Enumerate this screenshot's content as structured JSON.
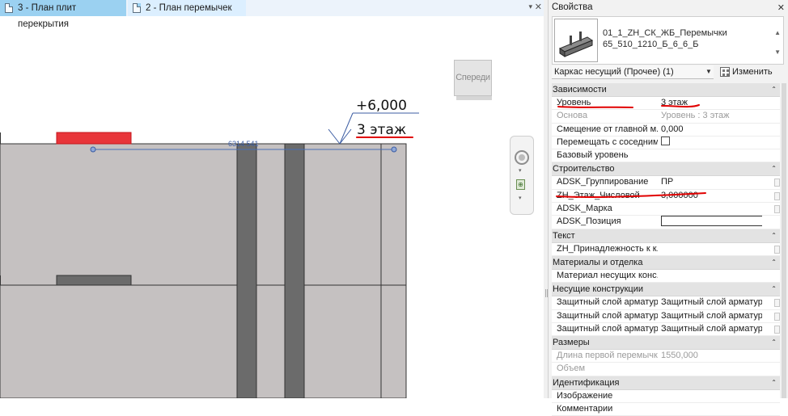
{
  "tabs": [
    {
      "label": "3 - План плит перекрытия"
    },
    {
      "label": "2 - План перемычек"
    }
  ],
  "view": {
    "level_elevation": "+6,000",
    "level_name": "3 этаж",
    "dimension_text": "6314.541",
    "viewcube_label": "Спереди"
  },
  "properties": {
    "title": "Свойства",
    "type_name_line1": "01_1_ZH_СК_ЖБ_Перемычки",
    "type_name_line2": "65_510_1210_Б_6_6_Б",
    "family_selector": "Каркас несущий (Прочее) (1)",
    "edit_type_label": "Изменить тип",
    "sections": [
      {
        "title": "Зависимости",
        "rows": [
          {
            "label": "Уровень",
            "value": "3 этаж"
          },
          {
            "label": "Основа",
            "value": "Уровень : 3 этаж"
          },
          {
            "label": "Смещение от главной м...",
            "value": "0,000"
          },
          {
            "label": "Перемещать с соседним...",
            "value": ""
          },
          {
            "label": "Базовый уровень",
            "value": ""
          }
        ]
      },
      {
        "title": "Строительство",
        "rows": [
          {
            "label": "ADSK_Группирование",
            "value": "ПР"
          },
          {
            "label": "ZH_Этаж_Числовой",
            "value": "3,000000"
          },
          {
            "label": "ADSK_Марка",
            "value": ""
          },
          {
            "label": "ADSK_Позиция",
            "value": ""
          }
        ]
      },
      {
        "title": "Текст",
        "rows": [
          {
            "label": "ZH_Принадлежность к к...",
            "value": ""
          }
        ]
      },
      {
        "title": "Материалы и отделка",
        "rows": [
          {
            "label": "Материал несущих конс...",
            "value": ""
          }
        ]
      },
      {
        "title": "Несущие конструкции",
        "rows": [
          {
            "label": "Защитный слой арматур...",
            "value": "Защитный слой арматур..."
          },
          {
            "label": "Защитный слой арматур...",
            "value": "Защитный слой арматур..."
          },
          {
            "label": "Защитный слой арматур...",
            "value": "Защитный слой арматур..."
          }
        ]
      },
      {
        "title": "Размеры",
        "rows": [
          {
            "label": "Длина первой перемычки",
            "value": "1550,000"
          },
          {
            "label": "Объем",
            "value": ""
          }
        ]
      },
      {
        "title": "Идентификация",
        "rows": [
          {
            "label": "Изображение",
            "value": ""
          },
          {
            "label": "Комментарии",
            "value": ""
          }
        ]
      }
    ]
  },
  "colors": {
    "accent_tab": "#9bd1f1",
    "selection_red": "#e10000",
    "wall_fill": "#c5c1c1",
    "column_fill": "#6b6b6b"
  }
}
